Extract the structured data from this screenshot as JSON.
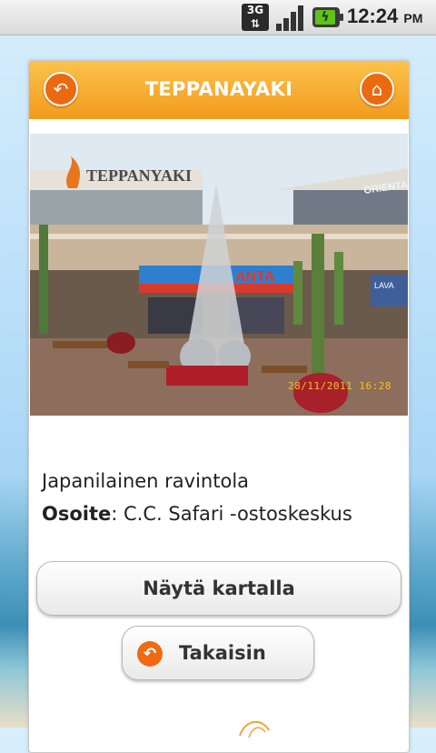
{
  "status_bar": {
    "network": "3G",
    "time": "12:24",
    "ampm": "PM"
  },
  "header": {
    "title": "TEPPANAYAKI",
    "back_icon": "back-arrow-icon",
    "home_icon": "home-icon"
  },
  "photo": {
    "sign_text": "TEPPANYAKI",
    "sign_text_right": "ORIENTA",
    "shop_sign": "ANTA",
    "side_sign": "LAVA",
    "date_stamp": "28/11/2011  16:28"
  },
  "details": {
    "category": "Japanilainen ravintola",
    "address_label": "Osoite",
    "address_value": ": C.C. Safari -ostoskeskus"
  },
  "buttons": {
    "show_on_map": "Näytä kartalla",
    "back": "Takaisin"
  },
  "colors": {
    "header_top": "#fbc24b",
    "header_bottom": "#f29b1c",
    "accent_orange": "#ec6a0f"
  }
}
